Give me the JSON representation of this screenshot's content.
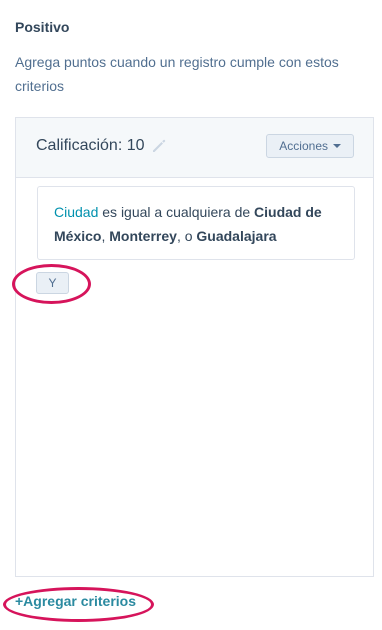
{
  "section": {
    "title": "Positivo",
    "description": "Agrega puntos cuando un registro cumple con estos criterios"
  },
  "rule_card": {
    "score_label": "Calificación: 10",
    "actions_label": "Acciones",
    "criteria": {
      "property": "Ciudad",
      "operator_text": " es igual a cualquiera de ",
      "value_1": "Ciudad de México",
      "sep_1": ", ",
      "value_2": "Monterrey",
      "sep_2": ", o ",
      "value_3": "Guadalajara"
    },
    "and_label": "Y"
  },
  "add_criteria_label": "+Agregar criterios",
  "colors": {
    "highlight": "#d6145b",
    "link": "#2b8aa0",
    "property": "#0091ae"
  },
  "icons": {
    "edit": "pencil-icon",
    "dropdown": "caret-down-icon"
  }
}
